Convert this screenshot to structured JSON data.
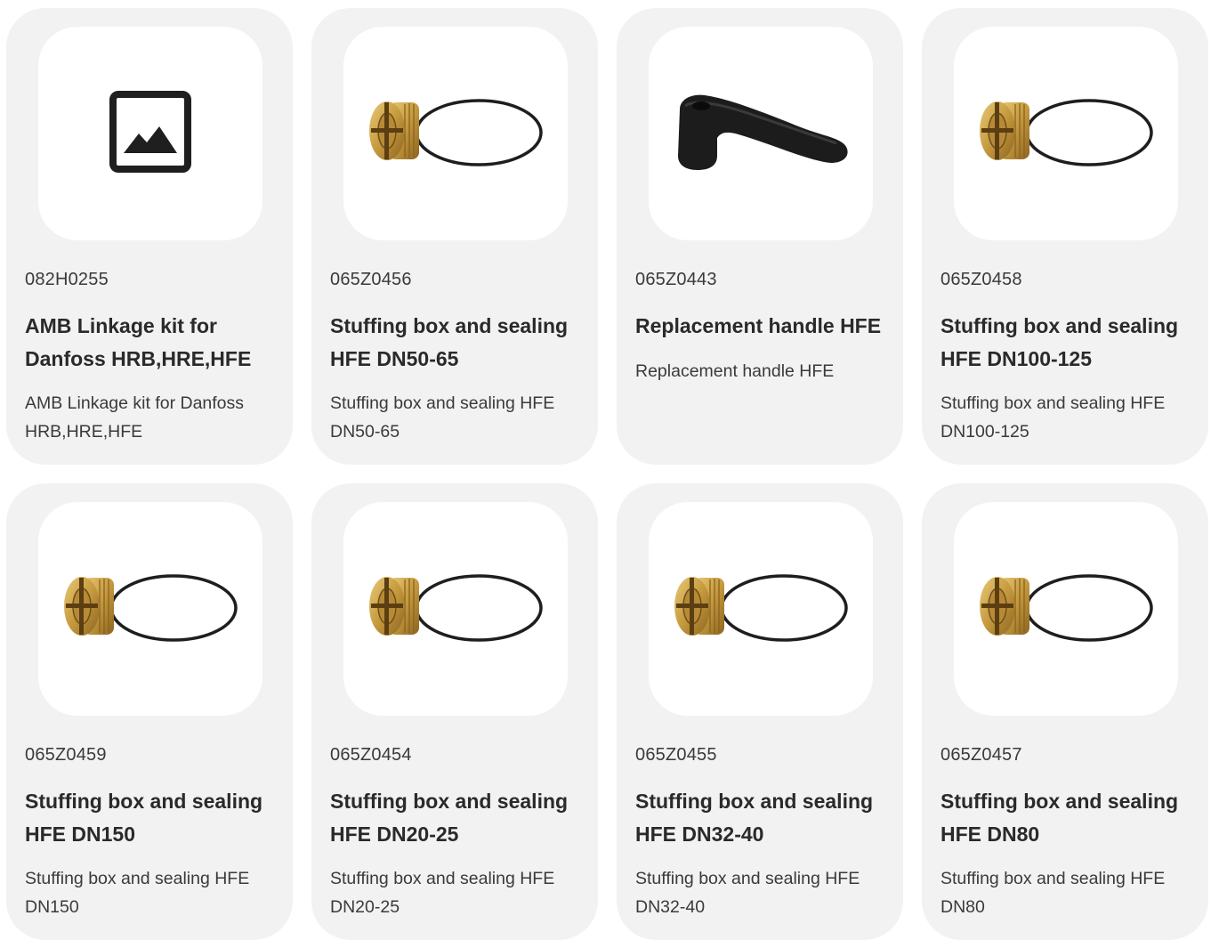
{
  "products": [
    {
      "code": "082H0255",
      "title": "AMB Linkage kit for Danfoss HRB,HRE,HFE",
      "description": "AMB Linkage kit for Danfoss HRB,HRE,HFE",
      "image_icon": "image-placeholder-icon"
    },
    {
      "code": "065Z0456",
      "title": "Stuffing box and sealing HFE DN50-65",
      "description": "Stuffing box and sealing HFE DN50-65",
      "image_icon": "stuffing-box-icon"
    },
    {
      "code": "065Z0443",
      "title": "Replacement handle HFE",
      "description": "Replacement handle HFE",
      "image_icon": "handle-icon"
    },
    {
      "code": "065Z0458",
      "title": "Stuffing box and sealing HFE DN100-125",
      "description": "Stuffing box and sealing HFE DN100-125",
      "image_icon": "stuffing-box-icon"
    },
    {
      "code": "065Z0459",
      "title": "Stuffing box and sealing HFE DN150",
      "description": "Stuffing box and sealing HFE DN150",
      "image_icon": "stuffing-box-icon"
    },
    {
      "code": "065Z0454",
      "title": "Stuffing box and sealing HFE DN20-25",
      "description": "Stuffing box and sealing HFE DN20-25",
      "image_icon": "stuffing-box-icon"
    },
    {
      "code": "065Z0455",
      "title": "Stuffing box and sealing HFE DN32-40",
      "description": "Stuffing box and sealing HFE DN32-40",
      "image_icon": "stuffing-box-icon"
    },
    {
      "code": "065Z0457",
      "title": "Stuffing box and sealing HFE DN80",
      "description": "Stuffing box and sealing HFE DN80",
      "image_icon": "stuffing-box-icon"
    }
  ],
  "colors": {
    "card_background": "#f2f2f2",
    "image_background": "#ffffff",
    "brass": "#c9a24a",
    "oring": "#1e1e1e",
    "handle": "#1c1c1c"
  }
}
